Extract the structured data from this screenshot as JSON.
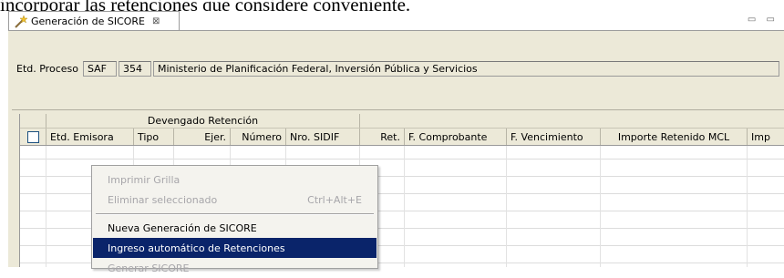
{
  "document": {
    "text": "incorporar las retenciones que considere conveniente."
  },
  "tab": {
    "title": "Generación de SICORE",
    "icon": "wand-icon",
    "close_glyph": "⊠",
    "window_controls": "▭ ▭"
  },
  "process": {
    "label": "Etd. Proceso",
    "code": "SAF",
    "number": "354",
    "description": "Ministerio de Planificación Federal, Inversión Pública y Servicios"
  },
  "grid": {
    "group_header": "Devengado Retención",
    "columns": [
      "Etd. Emisora",
      "Tipo",
      "Ejer.",
      "Número",
      "Nro. SIDIF",
      "Ret.",
      "F. Comprobante",
      "F. Vencimiento",
      "Importe Retenido MCL",
      "Imp"
    ],
    "rows": []
  },
  "context_menu": {
    "items": [
      {
        "label": "Imprimir Grilla",
        "accelerator": "",
        "enabled": false
      },
      {
        "label": "Eliminar seleccionado",
        "accelerator": "Ctrl+Alt+E",
        "enabled": false
      },
      {
        "label": "Nueva Generación de SICORE",
        "accelerator": "",
        "enabled": true
      },
      {
        "label": "Ingreso automático de Retenciones",
        "accelerator": "",
        "enabled": true,
        "selected": true
      },
      {
        "label": "Generar SICORE",
        "accelerator": "",
        "enabled": false
      }
    ]
  },
  "colors": {
    "panel_bg": "#ece9d8",
    "selection_bg": "#0a246a",
    "disabled_text": "#a7a6aa"
  }
}
